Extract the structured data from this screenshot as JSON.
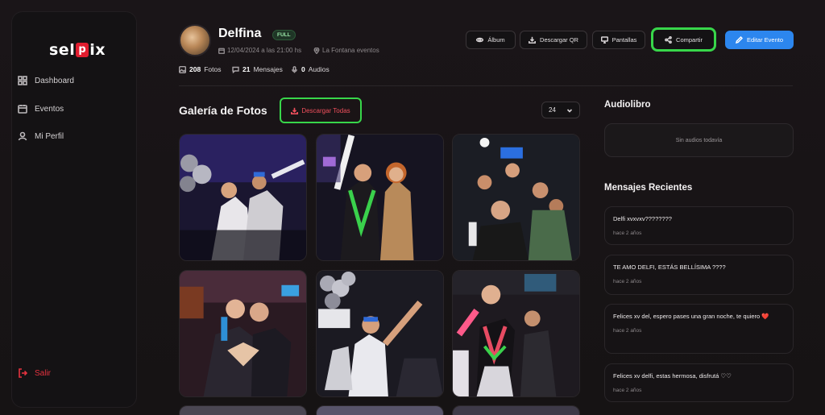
{
  "brand": {
    "logo_left": "sel",
    "logo_mark": "p",
    "logo_right": "ix"
  },
  "sidebar": {
    "items": [
      {
        "label": "Dashboard",
        "icon": "grid-icon"
      },
      {
        "label": "Eventos",
        "icon": "calendar-icon"
      },
      {
        "label": "Mi Perfil",
        "icon": "user-icon"
      }
    ],
    "logout_label": "Salir"
  },
  "profile": {
    "name": "Delfina",
    "plan_badge": "FULL",
    "date": "12/04/2024 a las 21:00 hs",
    "venue": "La Fontana eventos",
    "photos_count": "208",
    "photos_label": "Fotos",
    "messages_count": "21",
    "messages_label": "Mensajes",
    "audios_count": "0",
    "audios_label": "Audios"
  },
  "toolbar": {
    "album_label": "Álbum",
    "qr_label": "Descargar QR",
    "screens_label": "Pantallas",
    "share_label": "Compartir",
    "edit_label": "Editar Evento"
  },
  "gallery": {
    "title": "Galería de Fotos",
    "download_all_label": "Descargar Todas",
    "per_page_value": "24"
  },
  "audiobook": {
    "title": "Audiolibro",
    "empty_text": "Sin audios todavía"
  },
  "messages": {
    "title": "Mensajes Recientes",
    "items": [
      {
        "text": "Delfi xvxvxv????????",
        "time": "hace 2 años"
      },
      {
        "text": "TE AMO DELFI, ESTÁS BELLÍSIMA ????",
        "time": "hace 2 años"
      },
      {
        "text": "Felices xv del, espero pases una gran noche, te quiero ❤️",
        "time": "hace 2 años"
      },
      {
        "text": "Felices xv delfi, estas hermosa, disfrutá ♡♡",
        "time": "hace 2 años"
      }
    ]
  },
  "colors": {
    "accent_blue": "#2c86ee",
    "danger_red": "#e5323f",
    "highlight_green": "#38d64a"
  }
}
